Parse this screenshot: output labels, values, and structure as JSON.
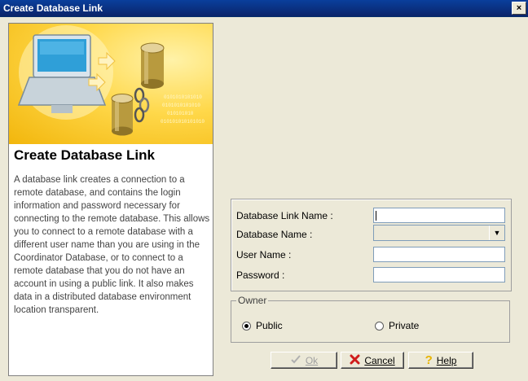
{
  "window": {
    "title": "Create Database Link",
    "close_glyph": "×"
  },
  "left_panel": {
    "heading": "Create Database Link",
    "description": "A database link creates a connection to a remote database, and contains the login information and password necessary for connecting to the remote database. This allows you to connect to a remote database with a different user name than you are using in the Coordinator Database, or to connect to a remote database that you do not have an account in using a public link. It also makes data in a distributed database environment location transparent.",
    "banner_binary": [
      "0101010101010",
      "0101010101010",
      "010101010",
      "010101010101010"
    ]
  },
  "form": {
    "link_name_label": "Database Link Name :",
    "link_name_value": "",
    "database_name_label": "Database Name :",
    "database_name_value": "",
    "user_name_label": "User Name :",
    "user_name_value": "",
    "password_label": "Password :",
    "password_value": ""
  },
  "owner": {
    "legend": "Owner",
    "public_label": "Public",
    "private_label": "Private",
    "selected": "Public"
  },
  "buttons": {
    "ok_label": "Ok",
    "cancel_label": "Cancel",
    "help_label": "Help"
  },
  "icons": {
    "ok": "ok-check-icon",
    "cancel": "cancel-x-icon",
    "help": "help-question-icon",
    "banner": "database-link-illustration"
  },
  "colors": {
    "titlebar": "#0A246A",
    "banner": "#FFD84A",
    "cancel_icon": "#D01C1C",
    "help_icon": "#E8B400"
  }
}
